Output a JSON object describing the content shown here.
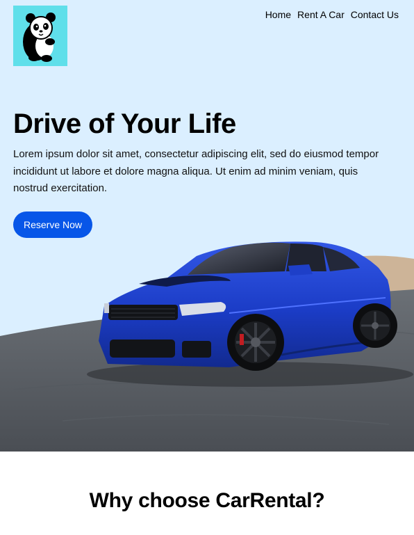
{
  "logo": {
    "icon": "panda-icon",
    "background": "#5fdfea"
  },
  "nav": {
    "items": [
      "Home",
      "Rent A Car",
      "Contact Us"
    ]
  },
  "hero": {
    "title": "Drive of Your Life",
    "text": "Lorem ipsum dolor sit amet, consectetur adipiscing elit, sed do eiusmod tempor incididunt ut labore et dolore magna aliqua. Ut enim ad minim veniam, quis nostrud exercitation.",
    "cta_label": "Reserve Now",
    "image": "blue-sports-sedan-on-asphalt"
  },
  "features": {
    "title": "Why choose CarRental?"
  },
  "colors": {
    "hero_bg": "#dbefff",
    "accent": "#0756e8",
    "logo_bg": "#5fdfea",
    "car": "#1b3cc6"
  }
}
